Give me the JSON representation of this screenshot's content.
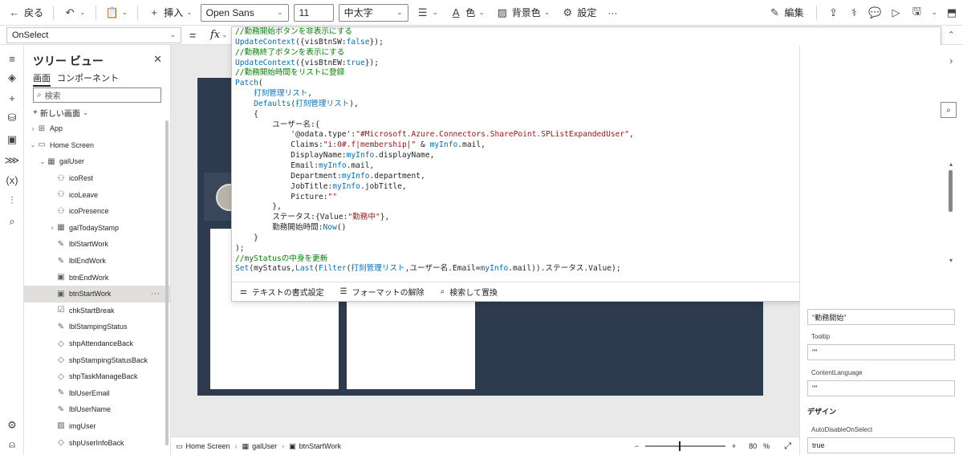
{
  "toolbar": {
    "back_label": "戻る",
    "insert_label": "挿入",
    "font_name": "Open Sans",
    "font_size": "11",
    "font_weight": "中太字",
    "color_label": "色",
    "fill_label": "背景色",
    "settings_label": "設定",
    "more_label": "···",
    "edit_label": "編集"
  },
  "formula_bar": {
    "property": "OnSelect",
    "eq": "=",
    "fx": "fx"
  },
  "tree": {
    "title": "ツリー ビュー",
    "tab_screens": "画面",
    "tab_components": "コンポーネント",
    "search_placeholder": "検索",
    "new_screen": "新しい画面",
    "items": [
      {
        "label": "App",
        "indent": 0,
        "icon": "app-icon",
        "caret": "›"
      },
      {
        "label": "Home Screen",
        "indent": 0,
        "icon": "screen-icon",
        "caret": "⌄"
      },
      {
        "label": "galUser",
        "indent": 1,
        "icon": "gallery-icon",
        "caret": "⌄"
      },
      {
        "label": "icoRest",
        "indent": 2,
        "icon": "icon-control-icon",
        "caret": ""
      },
      {
        "label": "icoLeave",
        "indent": 2,
        "icon": "icon-control-icon",
        "caret": ""
      },
      {
        "label": "icoPresence",
        "indent": 2,
        "icon": "icon-control-icon",
        "caret": ""
      },
      {
        "label": "galTodayStamp",
        "indent": 2,
        "icon": "gallery-icon",
        "caret": "›"
      },
      {
        "label": "lblStartWork",
        "indent": 2,
        "icon": "label-icon",
        "caret": ""
      },
      {
        "label": "lblEndWork",
        "indent": 2,
        "icon": "label-icon",
        "caret": ""
      },
      {
        "label": "btnEndWork",
        "indent": 2,
        "icon": "button-icon",
        "caret": ""
      },
      {
        "label": "btnStartWork",
        "indent": 2,
        "icon": "button-icon",
        "caret": "",
        "selected": true
      },
      {
        "label": "chkStartBreak",
        "indent": 2,
        "icon": "checkbox-icon",
        "caret": ""
      },
      {
        "label": "lblStampingStatus",
        "indent": 2,
        "icon": "label-icon",
        "caret": ""
      },
      {
        "label": "shpAttendanceBack",
        "indent": 2,
        "icon": "shape-icon",
        "caret": ""
      },
      {
        "label": "shpStampingStatusBack",
        "indent": 2,
        "icon": "shape-icon",
        "caret": ""
      },
      {
        "label": "shpTaskManageBack",
        "indent": 2,
        "icon": "shape-icon",
        "caret": ""
      },
      {
        "label": "lblUserEmail",
        "indent": 2,
        "icon": "label-icon",
        "caret": ""
      },
      {
        "label": "lblUserName",
        "indent": 2,
        "icon": "label-icon",
        "caret": ""
      },
      {
        "label": "imgUser",
        "indent": 2,
        "icon": "image-icon",
        "caret": ""
      },
      {
        "label": "shpUserInfoBack",
        "indent": 2,
        "icon": "shape-icon",
        "caret": ""
      }
    ],
    "more": "···"
  },
  "editor": {
    "footer_format": "テキストの書式設定",
    "footer_unformat": "フォーマットの解除",
    "footer_find": "検索して置換"
  },
  "properties": {
    "text_value": "\"勤務開始\"",
    "tooltip_label": "Tooltip",
    "tooltip_value": "\"\"",
    "content_language_label": "ContentLanguage",
    "content_language_value": "\"\"",
    "design_section": "デザイン",
    "auto_disable_label": "AutoDisableOnSelect",
    "auto_disable_value": "true"
  },
  "statusbar": {
    "crumb_screen": "Home Screen",
    "crumb_gallery": "galUser",
    "crumb_control": "btnStartWork",
    "zoom_minus": "−",
    "zoom_plus": "+",
    "zoom_value": "80",
    "zoom_unit": "%",
    "zoom_level": 0.42
  },
  "colors": {
    "app_background": "#2e3a4e",
    "comment": "#008000",
    "function": "#0070c0",
    "string": "#a31515"
  }
}
